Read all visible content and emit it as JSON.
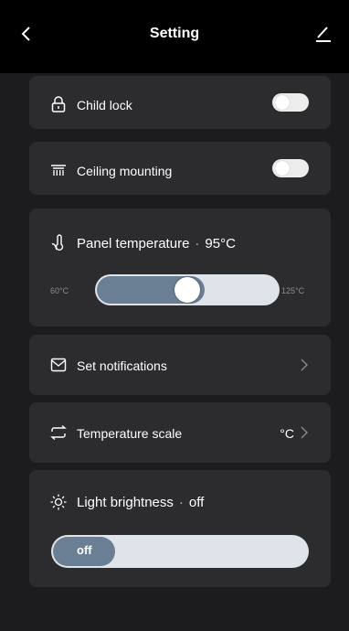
{
  "header": {
    "title": "Setting",
    "back_icon": "chevron-left-icon",
    "edit_icon": "pencil-icon"
  },
  "child_lock": {
    "label": "Child lock",
    "icon": "lock-icon",
    "enabled": false
  },
  "ceiling_mounting": {
    "label": "Ceiling mounting",
    "icon": "ceiling-heater-icon",
    "enabled": false
  },
  "panel_temperature": {
    "label": "Panel temperature",
    "separator": "·",
    "value": "95°C",
    "icon": "thermometer-hand-icon",
    "min_label": "60°C",
    "max_label": "125°C",
    "level": 0.54
  },
  "notifications": {
    "label": "Set notifications",
    "icon": "envelope-icon"
  },
  "temperature_scale": {
    "label": "Temperature scale",
    "value": "°C",
    "icon": "convert-arrows-icon"
  },
  "light_brightness": {
    "label": "Light brightness",
    "separator": "·",
    "value": "off",
    "icon": "sun-icon",
    "slider_text": "off",
    "level": 0.0
  },
  "colors": {
    "background": "#1c1c1e",
    "card": "#2c2c2e",
    "header": "#000000",
    "slider_fill": "#6a7f93",
    "slider_track": "#dfe3ea"
  }
}
